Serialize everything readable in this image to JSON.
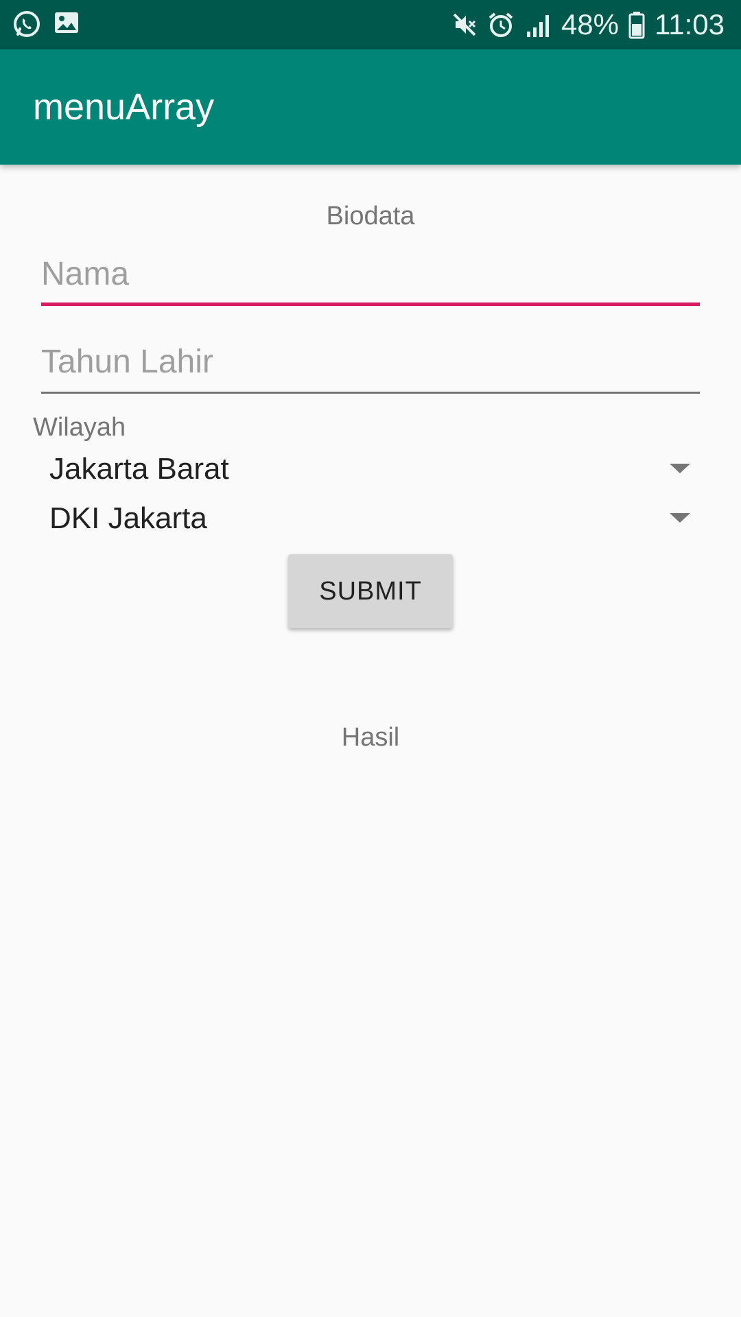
{
  "status_bar": {
    "left_icons": [
      "whatsapp-icon",
      "image-icon"
    ],
    "right_icons": [
      "mute-icon",
      "alarm-icon",
      "signal-icon",
      "battery-icon"
    ],
    "battery": "48%",
    "time": "11:03"
  },
  "app_bar": {
    "title": "menuArray",
    "color": "#008577"
  },
  "form": {
    "header": "Biodata",
    "nama_placeholder": "Nama",
    "tahun_lahir_placeholder": "Tahun Lahir",
    "wilayah_label": "Wilayah",
    "spinner_1_value": "Jakarta Barat",
    "spinner_2_value": "DKI Jakarta",
    "submit_label": "SUBMIT",
    "result_label": "Hasil",
    "accent_color": "#d81b60"
  }
}
